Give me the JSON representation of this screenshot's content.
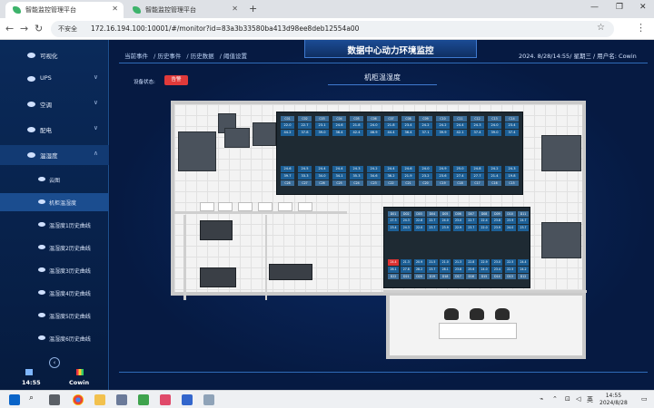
{
  "browser": {
    "tabs": [
      {
        "title": "智能监控管理平台"
      },
      {
        "title": "智能监控管理平台"
      }
    ],
    "security_label": "不安全",
    "url": "172.16.194.100:10001/#/monitor?id=83a3b33580ba413d98ee8deb12554a00"
  },
  "sidebar": {
    "items": [
      {
        "label": "可视化"
      },
      {
        "label": "UPS"
      },
      {
        "label": "空调"
      },
      {
        "label": "配电"
      },
      {
        "label": "温湿度"
      }
    ],
    "sub_items": [
      {
        "label": "云图"
      },
      {
        "label": "机柜温湿度"
      },
      {
        "label": "温湿度1历史曲线"
      },
      {
        "label": "温湿度2历史曲线"
      },
      {
        "label": "温湿度3历史曲线"
      },
      {
        "label": "温湿度4历史曲线"
      },
      {
        "label": "温湿度5历史曲线"
      },
      {
        "label": "温湿度6历史曲线"
      }
    ],
    "footer_time": "14:55",
    "footer_user": "Cowin"
  },
  "header": {
    "breadcrumbs": [
      "当前事件",
      "/ 历史事件",
      "/ 历史数据",
      "/ 阈值设置"
    ],
    "title": "数据中心动力环境监控",
    "datetime": "2024. 8/28/14:55/ 星期三 / 用户名: Cowin"
  },
  "content": {
    "subtitle": "机柜温湿度",
    "status_label": "设备状态:",
    "status_value": "告警"
  },
  "racks": {
    "row1_top": {
      "headers": [
        "C01",
        "C02",
        "C03",
        "C04",
        "C05",
        "C06",
        "C07",
        "C08",
        "C09",
        "C10",
        "C11",
        "C12",
        "C13",
        "C14"
      ],
      "temps": [
        "22.0",
        "22.7",
        "23.1",
        "24.6",
        "21.8",
        "24.0",
        "21.8",
        "23.4",
        "24.2",
        "24.2",
        "24.4",
        "24.3",
        "24.0",
        "23.4"
      ],
      "hums": [
        "44.2",
        "37.8",
        "39.0",
        "36.4",
        "42.4",
        "46.9",
        "44.4",
        "36.4",
        "37.1",
        "39.9",
        "42.1",
        "37.4",
        "39.0",
        "37.4"
      ]
    },
    "row1_bottom": {
      "headers": [
        "C28",
        "C27",
        "C26",
        "C25",
        "C24",
        "C23",
        "C22",
        "C21",
        "C20",
        "C19",
        "C18",
        "C17",
        "C16",
        "C15"
      ],
      "temps": [
        "24.6",
        "24.5",
        "24.4",
        "24.4",
        "24.3",
        "24.2",
        "24.4",
        "24.6",
        "24.0",
        "24.9",
        "25.0",
        "24.8",
        "24.2",
        "24.3"
      ],
      "hums": [
        "39.7",
        "33.3",
        "34.0",
        "34.1",
        "35.3",
        "34.6",
        "36.2",
        "21.9",
        "23.2",
        "23.6",
        "27.4",
        "27.7",
        "21.4",
        "19.8"
      ]
    },
    "row2_top": {
      "headers": [
        "D01",
        "D02",
        "D03",
        "D04",
        "D05",
        "D06",
        "D07",
        "D08",
        "D09",
        "D10",
        "D11"
      ],
      "temps": [
        "27.3",
        "24.3",
        "22.8",
        "22.7",
        "24.0",
        "23.0",
        "22.7",
        "22.4",
        "23.8",
        "23.9",
        "24.7"
      ],
      "hums": [
        "23.4",
        "24.3",
        "22.0",
        "23.7",
        "23.9",
        "22.9",
        "23.7",
        "22.0",
        "23.9",
        "24.0",
        "23.7"
      ]
    },
    "row2_bottom": {
      "headers": [
        "D22",
        "D21",
        "D20",
        "D19",
        "D18",
        "D17",
        "D16",
        "D15",
        "D14",
        "D13",
        "D12"
      ],
      "temps": [
        "24.4",
        "21.3",
        "20.9",
        "21.5",
        "21.0",
        "21.3",
        "22.8",
        "22.9",
        "23.0",
        "22.5",
        "24.4"
      ],
      "hums": [
        "26.1",
        "27.8",
        "28.2",
        "23.7",
        "28.1",
        "23.8",
        "25.6",
        "24.0",
        "23.4",
        "22.5",
        "24.2"
      ]
    }
  },
  "taskbar": {
    "time": "14:55",
    "date": "2024/8/28",
    "ime": "英"
  }
}
